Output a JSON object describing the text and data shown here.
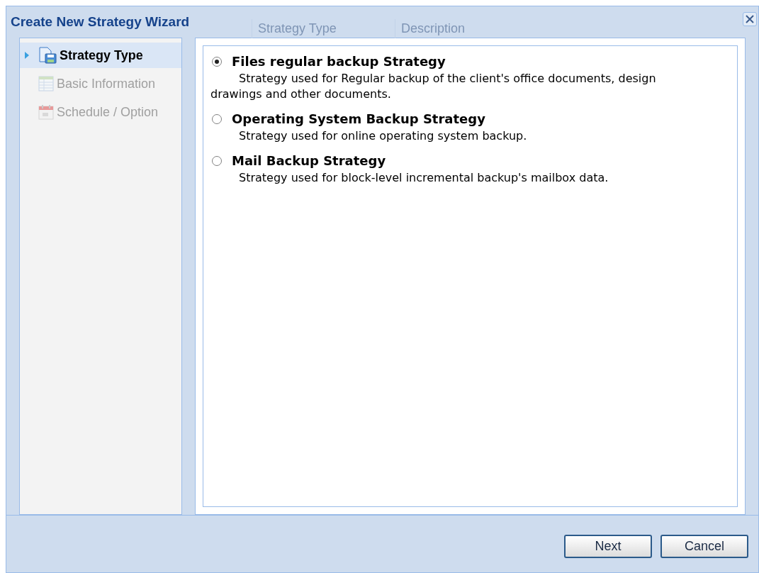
{
  "window": {
    "title": "Create New Strategy Wizard"
  },
  "background_columns": [
    "Strategy Type",
    "Description"
  ],
  "steps": [
    {
      "label": "Strategy Type",
      "selected": true,
      "disabled": false
    },
    {
      "label": "Basic Information",
      "selected": false,
      "disabled": true
    },
    {
      "label": "Schedule / Option",
      "selected": false,
      "disabled": true
    }
  ],
  "options": [
    {
      "title": "Files regular backup Strategy",
      "description": "Strategy used for Regular backup of the client's office documents, design drawings and other documents.",
      "selected": true
    },
    {
      "title": "Operating System Backup Strategy",
      "description": "Strategy used for online operating system backup.",
      "selected": false
    },
    {
      "title": "Mail Backup Strategy",
      "description": "Strategy used for block-level incremental backup's mailbox data.",
      "selected": false
    }
  ],
  "buttons": [
    "Next",
    "Cancel"
  ]
}
